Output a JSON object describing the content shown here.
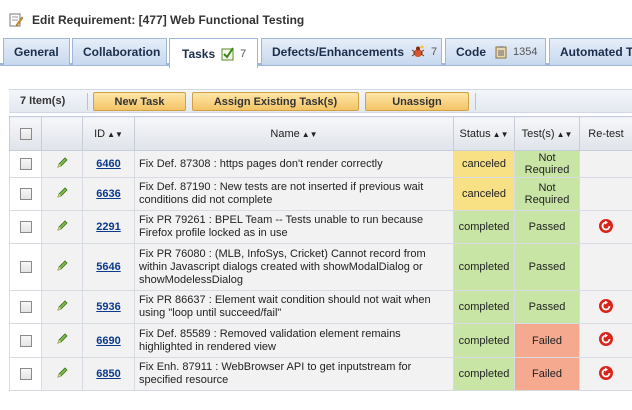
{
  "header": {
    "title": "Edit Requirement: [477] Web Functional Testing"
  },
  "tabs": [
    {
      "label": "General",
      "count": ""
    },
    {
      "label": "Collaboration",
      "count": ""
    },
    {
      "label": "Tasks",
      "count": "7"
    },
    {
      "label": "Defects/Enhancements",
      "count": "7"
    },
    {
      "label": "Code",
      "count": "1354"
    },
    {
      "label": "Automated Te",
      "count": ""
    }
  ],
  "toolbar": {
    "item_count": "7 Item(s)",
    "new_task": "New Task",
    "assign_existing": "Assign Existing Task(s)",
    "unassign": "Unassign"
  },
  "table": {
    "headers": {
      "id": "ID",
      "name": "Name",
      "status": "Status",
      "tests": "Test(s)",
      "retest": "Re-test"
    },
    "rows": [
      {
        "id": "6460",
        "name": "Fix Def. 87308 : https pages don't render correctly",
        "status": "canceled",
        "tests": "Not Required",
        "retest": false
      },
      {
        "id": "6636",
        "name": "Fix Def. 87190 : New tests are not inserted if previous wait conditions did not complete",
        "status": "canceled",
        "tests": "Not Required",
        "retest": false
      },
      {
        "id": "2291",
        "name": "Fix PR 79261 : BPEL Team -- Tests unable to run because Firefox profile locked as in use",
        "status": "completed",
        "tests": "Passed",
        "retest": true
      },
      {
        "id": "5646",
        "name": "Fix PR 76080 : (MLB, InfoSys, Cricket) Cannot record from within Javascript dialogs created with showModalDialog or showModelessDialog",
        "status": "completed",
        "tests": "Passed",
        "retest": false
      },
      {
        "id": "5936",
        "name": "Fix PR 86637 : Element wait condition should not wait when using \"loop until succeed/fail\"",
        "status": "completed",
        "tests": "Passed",
        "retest": true
      },
      {
        "id": "6690",
        "name": "Fix Def. 85589 : Removed validation element remains highlighted in rendered view",
        "status": "completed",
        "tests": "Failed",
        "retest": true
      },
      {
        "id": "6850",
        "name": "Fix Enh. 87911 : WebBrowser API to get inputstream for specified resource",
        "status": "completed",
        "tests": "Failed",
        "retest": true
      }
    ]
  },
  "colors": {
    "canceled": "#f8e084",
    "completed": "#c8e5a6",
    "failed": "#f5a98f",
    "tab_border": "#9fb8d8",
    "button": "#f3c466"
  },
  "icons": {
    "title": "document-edit-icon",
    "tasks_tab": "checklist-icon",
    "defects_tab": "bug-icon",
    "code_tab": "clipboard-icon",
    "row_edit": "pencil-icon",
    "retest": "refresh-icon"
  }
}
